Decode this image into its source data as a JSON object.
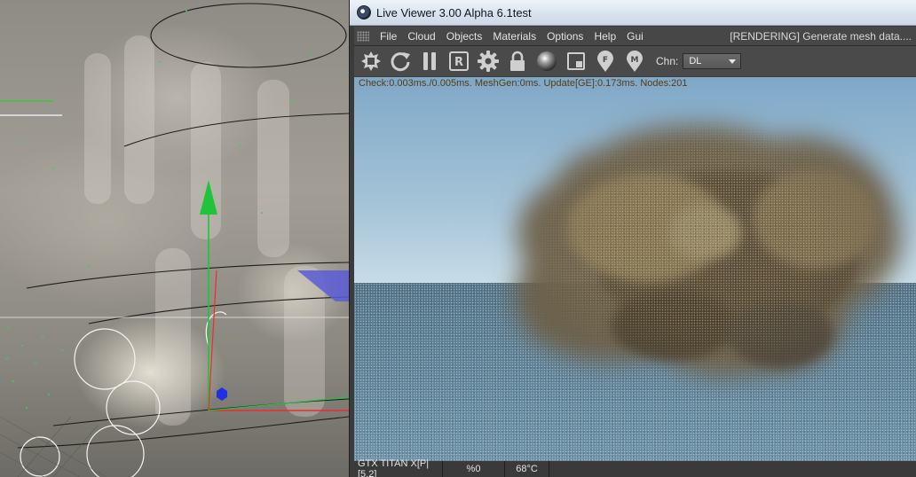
{
  "window": {
    "title": "Live Viewer 3.00 Alpha 6.1test"
  },
  "menu": {
    "items": [
      "File",
      "Cloud",
      "Objects",
      "Materials",
      "Options",
      "Help",
      "Gui"
    ],
    "status": "[RENDERING] Generate mesh data...."
  },
  "toolbar": {
    "icons": [
      "aperture-icon",
      "refresh-icon",
      "pause-icon",
      "region-r-icon",
      "settings-gear-icon",
      "lock-icon",
      "material-sphere-icon",
      "frame-icon",
      "focus-pin-icon",
      "material-pin-icon"
    ],
    "channel_label": "Chn:",
    "channel_value": "DL"
  },
  "render": {
    "stats": "Check:0.003ms./0.005ms. MeshGen:0ms. Update[GE]:0.173ms. Nodes:201"
  },
  "statusbar": {
    "gpu": "GTX TITAN X[P|[5.2]",
    "load": "%0",
    "temp": "68°C"
  }
}
